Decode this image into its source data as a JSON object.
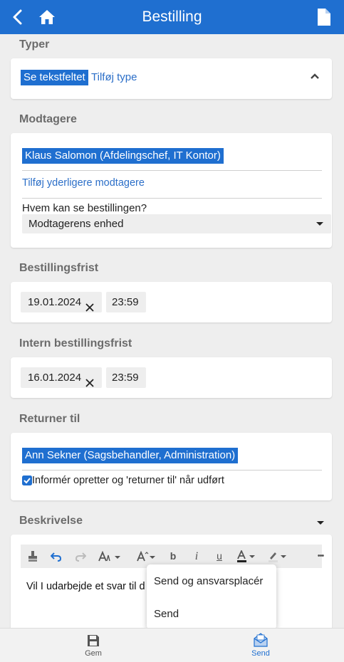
{
  "header": {
    "title": "Bestilling",
    "back_icon": "chevron-left-icon",
    "home_icon": "home-icon",
    "document_icon": "document-icon"
  },
  "types": {
    "section_title": "Typer",
    "chip_label": "Se tekstfeltet",
    "add_link": "Tilføj type"
  },
  "recipients": {
    "section_title": "Modtagere",
    "recipient_chip": "Klaus Salomon (Afdelingschef, IT Kontor)",
    "add_more_link": "Tilføj yderligere modtagere",
    "visibility_label": "Hvem kan se bestillingen?",
    "visibility_value": "Modtagerens enhed"
  },
  "deadline": {
    "section_title": "Bestillingsfrist",
    "date": "19.01.2024",
    "time": "23:59"
  },
  "internal_deadline": {
    "section_title": "Intern bestillingsfrist",
    "date": "16.01.2024",
    "time": "23:59"
  },
  "return_to": {
    "section_title": "Returner til",
    "person_chip": "Ann Sekner (Sagsbehandler, Administration)",
    "notify_label": "Informér opretter og 'returner til' når udført",
    "notify_checked": true
  },
  "description": {
    "section_title": "Beskrivelse",
    "text": "Vil I udarbejde et svar til d",
    "toolbar_icons": [
      "paint-bucket-icon",
      "undo-icon",
      "redo-icon",
      "font-family-icon",
      "font-size-icon",
      "bold-icon",
      "italic-icon",
      "underline-icon",
      "text-color-icon",
      "highlight-icon",
      "more-icon"
    ],
    "toolbar_labels": {
      "bold": "b",
      "italic": "i",
      "underline": "u",
      "more": "•••"
    }
  },
  "send_menu": {
    "items": [
      "Send og ansvarsplacér",
      "Send"
    ]
  },
  "bottom_bar": {
    "save_label": "Gem",
    "send_label": "Send"
  },
  "colors": {
    "primary": "#1f6fd0",
    "background": "#eeeeee"
  }
}
